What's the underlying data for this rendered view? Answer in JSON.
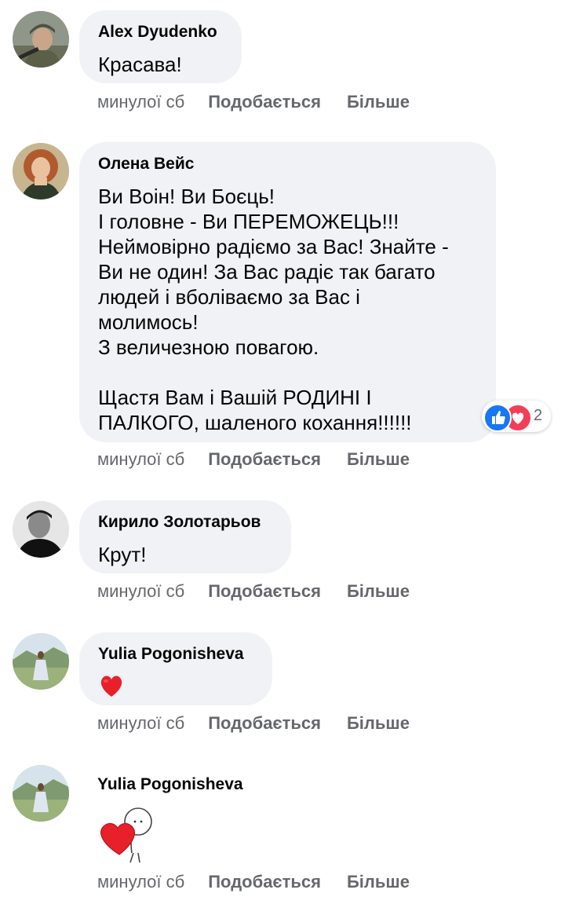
{
  "comments": [
    {
      "author": "Alex Dyudenko",
      "text": "Красава!",
      "time": "минулої сб",
      "like_label": "Подобається",
      "more_label": "Більше"
    },
    {
      "author": "Олена Вейс",
      "text": "Ви Воін! Ви Боєць!\nІ головне - Ви ПЕРЕМОЖЕЦЬ!!!\nНеймовірно радіємо за Вас! Знайте -\nВи не один! За Вас радіє так багато\nлюдей і вболіваємо за Вас і\nмолимось!\nЗ величезною повагою.\n\nЩастя Вам і Вашій РОДИНІ І\nПАЛКОГО, шаленого кохання!!!!!!",
      "time": "минулої сб",
      "like_label": "Подобається",
      "more_label": "Більше",
      "reactions": {
        "icons": [
          "like-icon",
          "love-icon"
        ],
        "count": "2"
      }
    },
    {
      "author": "Кирило Золотарьов",
      "text": "Крут!",
      "time": "минулої сб",
      "like_label": "Подобається",
      "more_label": "Більше"
    },
    {
      "author": "Yulia Pogonisheva",
      "content": "heart-emoji",
      "time": "минулої сб",
      "like_label": "Подобається",
      "more_label": "Більше"
    },
    {
      "author": "Yulia Pogonisheva",
      "content": "heart-hug-sticker",
      "time": "минулої сб",
      "like_label": "Подобається",
      "more_label": "Більше"
    }
  ],
  "colors": {
    "bubble": "#f0f2f5",
    "meta_text": "#65676b",
    "like_blue": "#1877f2",
    "love_red": "#f33e58"
  }
}
